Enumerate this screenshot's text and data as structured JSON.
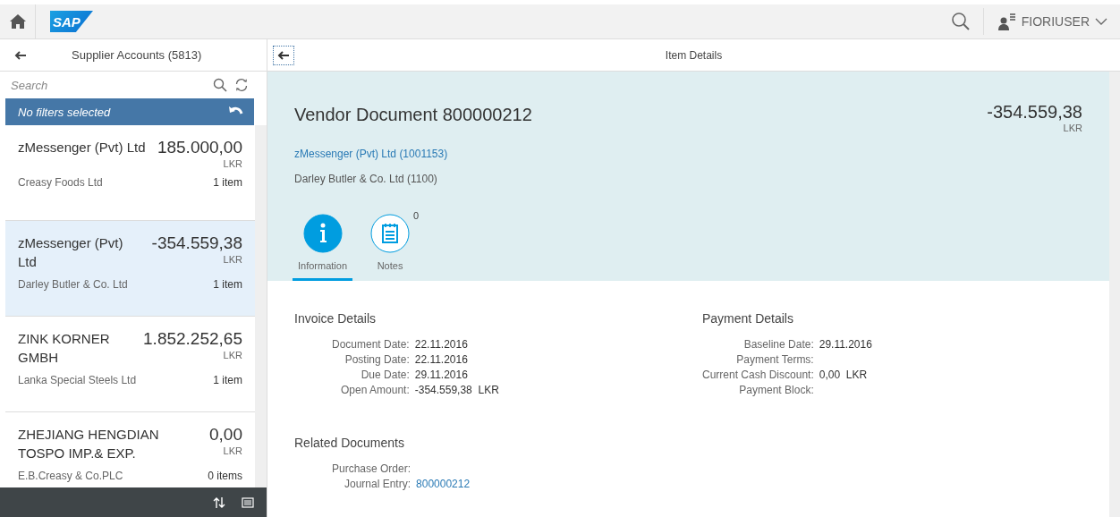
{
  "shell": {
    "logo": "SAP",
    "user": "FIORIUSER"
  },
  "master": {
    "title": "Supplier Accounts (5813)",
    "search": {
      "placeholder": "Search"
    },
    "filter_info": "No filters selected",
    "items": [
      {
        "title": "zMessenger (Pvt) Ltd",
        "amount": "185.000,00",
        "currency": "LKR",
        "subtitle": "Creasy Foods Ltd",
        "count": "1 item",
        "selected": false
      },
      {
        "title": "zMessenger (Pvt) Ltd",
        "amount": "-354.559,38",
        "currency": "LKR",
        "subtitle": "Darley Butler & Co. Ltd",
        "count": "1 item",
        "selected": true
      },
      {
        "title": "ZINK KORNER GMBH",
        "amount": "1.852.252,65",
        "currency": "LKR",
        "subtitle": "Lanka Special Steels Ltd",
        "count": "1 item",
        "selected": false
      },
      {
        "title": "ZHEJIANG HENGDIAN TOSPO IMP.& EXP.",
        "amount": "0,00",
        "currency": "LKR",
        "subtitle": "E.B.Creasy & Co.PLC",
        "count": "0 items",
        "selected": false
      }
    ]
  },
  "detail": {
    "title": "Item Details",
    "header": {
      "title": "Vendor Document 800000212",
      "amount": "-354.559,38",
      "currency": "LKR",
      "link": "zMessenger (Pvt) Ltd (1001153)",
      "attribute": "Darley Butler & Co. Ltd (1100)"
    },
    "tabs": [
      {
        "label": "Information",
        "kind": "info",
        "selected": true
      },
      {
        "label": "Notes",
        "kind": "notes",
        "count": "0",
        "selected": false
      }
    ],
    "sections": [
      {
        "title": "Invoice Details",
        "fields": [
          {
            "label": "Document Date:",
            "value": "22.11.2016"
          },
          {
            "label": "Posting Date:",
            "value": "22.11.2016"
          },
          {
            "label": "Due Date:",
            "value": "29.11.2016"
          },
          {
            "label": "Open Amount:",
            "value": "-354.559,38",
            "unit": "LKR"
          }
        ]
      },
      {
        "title": "Payment Details",
        "fields": [
          {
            "label": "Baseline Date:",
            "value": "29.11.2016"
          },
          {
            "label": "Payment Terms:"
          },
          {
            "label": "Current Cash Discount:",
            "value": "0,00",
            "unit": "LKR"
          },
          {
            "label": "Payment Block:"
          }
        ]
      },
      {
        "title": "Related Documents",
        "fields": [
          {
            "label": "Purchase Order:"
          },
          {
            "label": "Journal Entry:",
            "value": "800000212",
            "kind": "link"
          }
        ]
      }
    ]
  }
}
